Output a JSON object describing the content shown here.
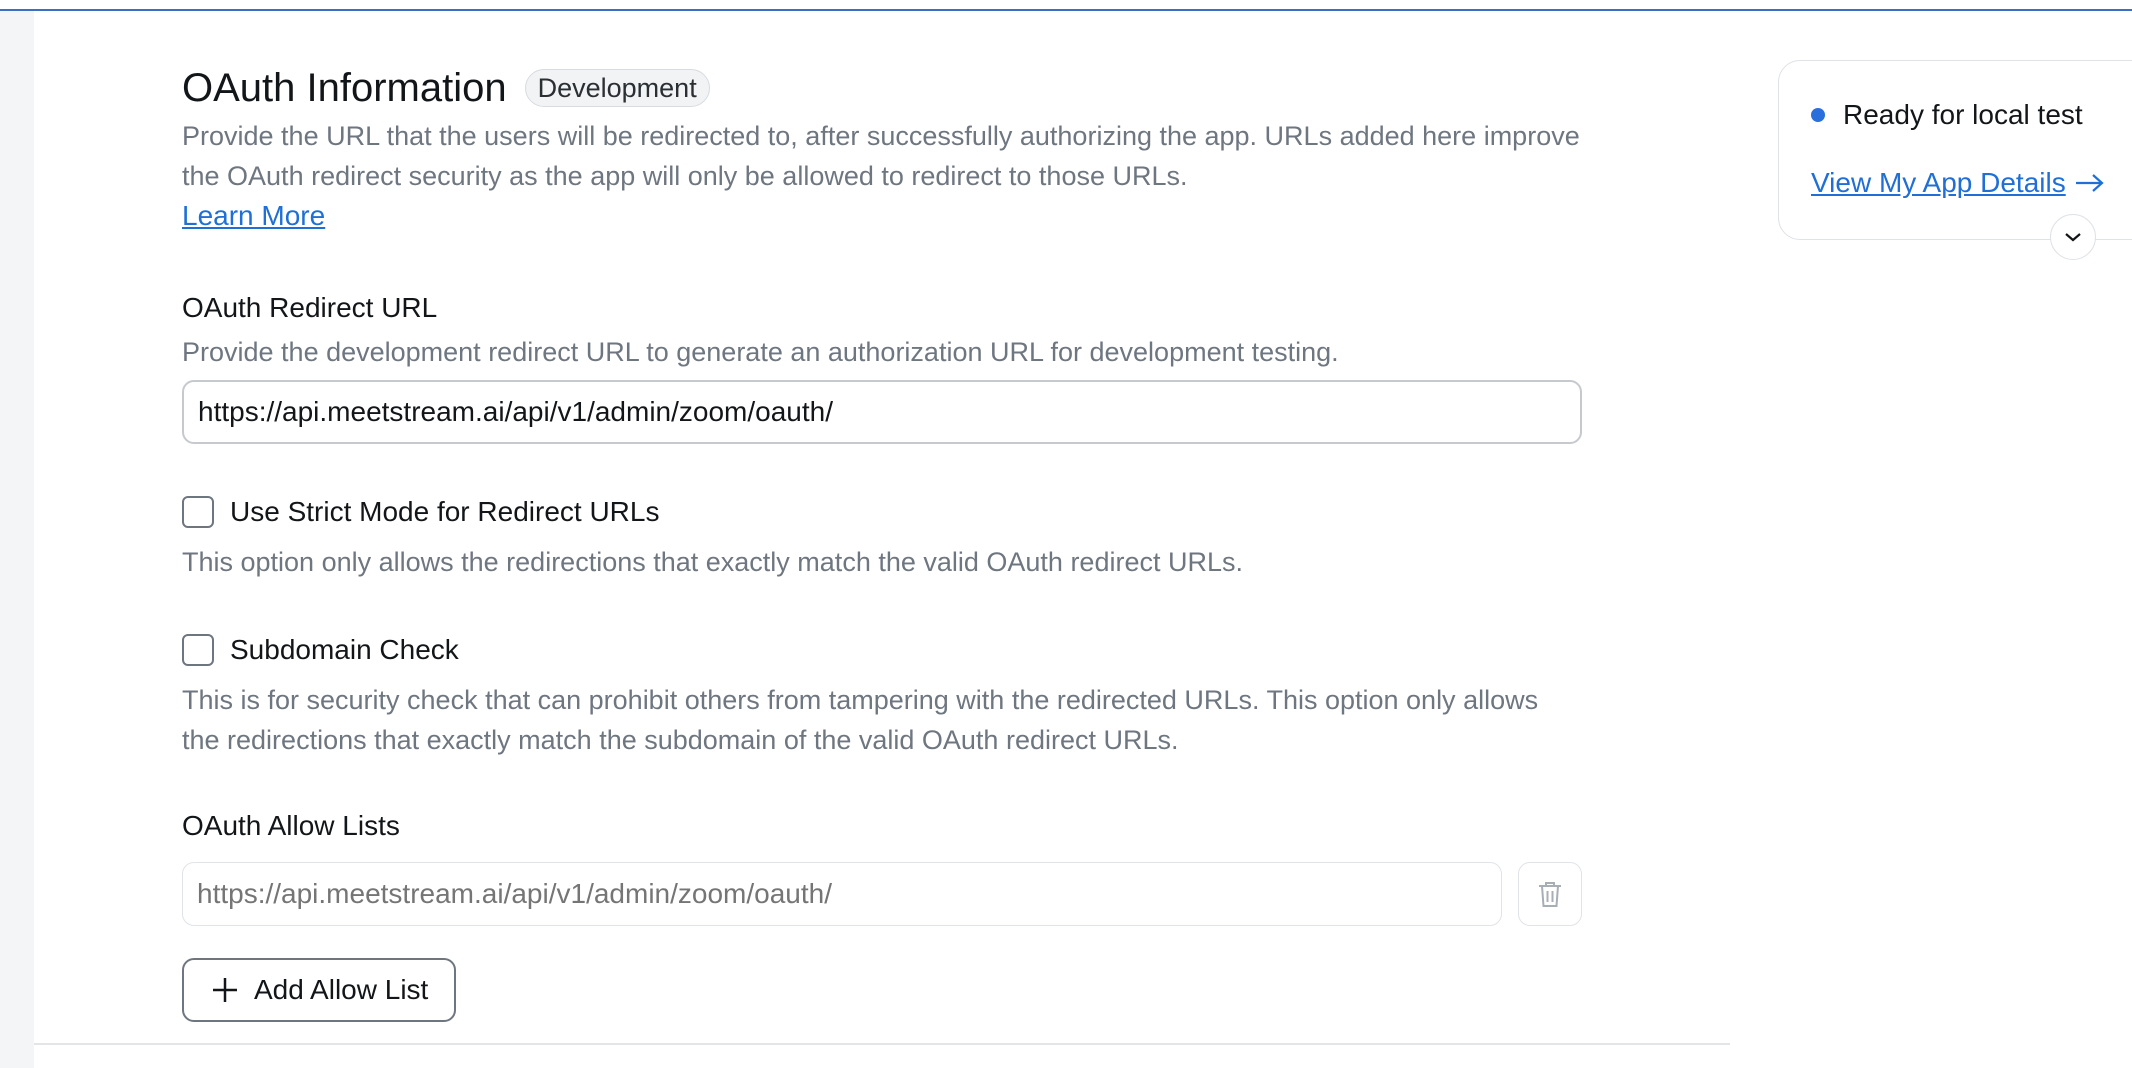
{
  "header": {
    "title": "OAuth Information",
    "badge": "Development",
    "description": "Provide the URL that the users will be redirected to, after successfully authorizing the app. URLs added here improve the OAuth redirect security as the app will only be allowed to redirect to those URLs.",
    "learn_more": "Learn More"
  },
  "redirect": {
    "label": "OAuth Redirect URL",
    "help": "Provide the development redirect URL to generate an authorization URL for development testing.",
    "value": "https://api.meetstream.ai/api/v1/admin/zoom/oauth/"
  },
  "strict_mode": {
    "label": "Use Strict Mode for Redirect URLs",
    "help": "This option only allows the redirections that exactly match the valid OAuth redirect URLs.",
    "checked": false
  },
  "subdomain": {
    "label": "Subdomain Check",
    "help": "This is for security check that can prohibit others from tampering with the redirected URLs. This option only allows the redirections that exactly match the subdomain of the valid OAuth redirect URLs.",
    "checked": false
  },
  "allow_lists": {
    "label": "OAuth Allow Lists",
    "placeholder": "https://api.meetstream.ai/api/v1/admin/zoom/oauth/",
    "add_label": "Add Allow List"
  },
  "status_card": {
    "status": "Ready for local test",
    "details_link": "View My App Details",
    "accent": "#2a6fdb"
  },
  "icons": {
    "trash": "trash-icon",
    "plus": "plus-icon",
    "arrow": "arrow-right-icon",
    "chevron": "chevron-down-icon"
  }
}
